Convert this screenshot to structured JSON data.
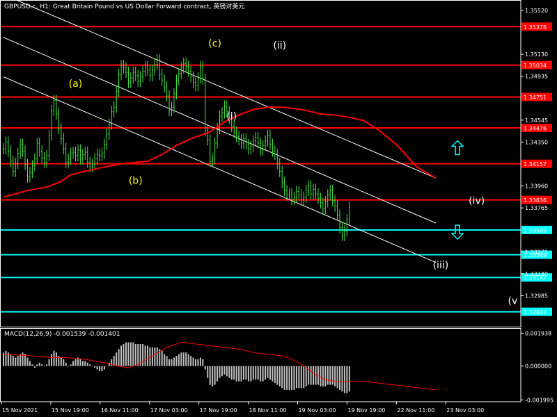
{
  "header": {
    "title": "GBPUSD.c, H1:  Great Britain Pound vs US Dollar Forward contract, 英镑对美元"
  },
  "chart_data": {
    "type": "candlestick",
    "symbol": "GBPUSD.c",
    "timeframe": "H1",
    "price_axis": {
      "ylim": [
        1.3271,
        1.356
      ],
      "ticks": [
        "1.35520",
        "1.35130",
        "1.34935",
        "1.34545",
        "1.34350",
        "1.33960",
        "1.33765",
        "1.33375",
        "1.33180",
        "1.32985"
      ]
    },
    "x_axis": {
      "labels": [
        "15 Nov 2021",
        "15 Nov 19:00",
        "16 Nov 11:00",
        "17 Nov 03:00",
        "17 Nov 19:00",
        "18 Nov 11:00",
        "19 Nov 03:00",
        "19 Nov 19:00",
        "22 Nov 11:00",
        "23 Nov 03:00"
      ]
    },
    "price_closes": [
      1.3429,
      1.3435,
      1.3427,
      1.3418,
      1.3409,
      1.3416,
      1.3425,
      1.3433,
      1.3427,
      1.3415,
      1.3404,
      1.3408,
      1.3414,
      1.342,
      1.3434,
      1.3427,
      1.3421,
      1.3417,
      1.3423,
      1.3441,
      1.3463,
      1.3472,
      1.346,
      1.3447,
      1.3438,
      1.3429,
      1.3417,
      1.342,
      1.3425,
      1.3426,
      1.3423,
      1.3428,
      1.342,
      1.3424,
      1.3426,
      1.3417,
      1.3413,
      1.3415,
      1.342,
      1.3424,
      1.3423,
      1.3425,
      1.3433,
      1.3442,
      1.3451,
      1.3462,
      1.3466,
      1.348,
      1.3495,
      1.3503,
      1.3501,
      1.3497,
      1.3488,
      1.3492,
      1.3497,
      1.3494,
      1.3489,
      1.3493,
      1.3498,
      1.3502,
      1.3499,
      1.3494,
      1.3499,
      1.3504,
      1.3508,
      1.3495,
      1.349,
      1.3484,
      1.3476,
      1.3463,
      1.3466,
      1.3478,
      1.349,
      1.3496,
      1.3501,
      1.3505,
      1.3502,
      1.3498,
      1.3493,
      1.3488,
      1.3485,
      1.3492,
      1.3502,
      1.3491,
      1.3445,
      1.3437,
      1.3418,
      1.342,
      1.3434,
      1.3447,
      1.3458,
      1.3461,
      1.3467,
      1.3462,
      1.3456,
      1.3449,
      1.3444,
      1.344,
      1.3437,
      1.3434,
      1.3438,
      1.3433,
      1.3429,
      1.3431,
      1.3436,
      1.3439,
      1.3434,
      1.3428,
      1.3432,
      1.3436,
      1.3441,
      1.3433,
      1.3427,
      1.3424,
      1.3416,
      1.3409,
      1.3399,
      1.3392,
      1.3388,
      1.3389,
      1.3384,
      1.3386,
      1.3391,
      1.3388,
      1.3384,
      1.3386,
      1.3392,
      1.3396,
      1.3389,
      1.3393,
      1.3389,
      1.3385,
      1.3381,
      1.3376,
      1.3382,
      1.3388,
      1.3392,
      1.3383,
      1.3378,
      1.337,
      1.3359,
      1.3352,
      1.3356,
      1.3366,
      1.3377
    ],
    "moving_average": {
      "color": "#ff0000",
      "values": [
        [
          0,
          1.3386
        ],
        [
          10,
          1.3392
        ],
        [
          18,
          1.3395
        ],
        [
          24,
          1.34
        ],
        [
          28,
          1.3406
        ],
        [
          40,
          1.3412
        ],
        [
          50,
          1.3416
        ],
        [
          60,
          1.3418
        ],
        [
          66,
          1.3424
        ],
        [
          72,
          1.3432
        ],
        [
          78,
          1.3438
        ],
        [
          86,
          1.3444
        ],
        [
          92,
          1.3453
        ],
        [
          98,
          1.3459
        ],
        [
          104,
          1.3464
        ],
        [
          110,
          1.3466
        ],
        [
          116,
          1.3466
        ],
        [
          124,
          1.3464
        ],
        [
          132,
          1.346
        ],
        [
          138,
          1.3459
        ],
        [
          144,
          1.3457
        ],
        [
          150,
          1.3454
        ],
        [
          156,
          1.3446
        ],
        [
          164,
          1.3432
        ],
        [
          172,
          1.3413
        ],
        [
          180,
          1.3403
        ]
      ]
    },
    "horizontal_levels": [
      {
        "value": "1.35376",
        "price": 1.35376,
        "color": "#ff0000"
      },
      {
        "value": "1.35034",
        "price": 1.35034,
        "color": "#ff0000"
      },
      {
        "value": "1.34751",
        "price": 1.34751,
        "color": "#ff0000"
      },
      {
        "value": "1.34476",
        "price": 1.34476,
        "color": "#ff0000"
      },
      {
        "value": "1.34157",
        "price": 1.34157,
        "color": "#ff0000"
      },
      {
        "value": "1.33836",
        "price": 1.33836,
        "color": "#ff0000"
      },
      {
        "value": "1.33569",
        "price": 1.33569,
        "color": "#00ffff"
      },
      {
        "value": "1.33349",
        "price": 1.33349,
        "color": "#00ffff"
      },
      {
        "value": "1.33147",
        "price": 1.33147,
        "color": "#00ffff"
      },
      {
        "value": "1.32842",
        "price": 1.32842,
        "color": "#00ffff"
      }
    ],
    "channel": {
      "color": "#ffffff",
      "lines": [
        [
          [
            0,
            1.3566
          ],
          [
            180,
            1.3403
          ]
        ],
        [
          [
            0,
            1.3528
          ],
          [
            180,
            1.3363
          ]
        ],
        [
          [
            0,
            1.3493
          ],
          [
            180,
            1.3328
          ]
        ]
      ]
    },
    "wave_labels": [
      {
        "text": "(a)",
        "bar": 30,
        "price": 1.3484,
        "color": "#ffff00"
      },
      {
        "text": "(b)",
        "bar": 55,
        "price": 1.3398,
        "color": "#ffff00"
      },
      {
        "text": "(c)",
        "bar": 88,
        "price": 1.352,
        "color": "#ffff00"
      },
      {
        "text": "(ii)",
        "bar": 115,
        "price": 1.3518,
        "color": "#ffffff"
      },
      {
        "text": "(i)",
        "bar": 95,
        "price": 1.3455,
        "color": "#ffffff"
      },
      {
        "text": "(iv)",
        "bar": 197,
        "price": 1.338,
        "color": "#ffffff"
      },
      {
        "text": "(iii)",
        "bar": 182,
        "price": 1.3323,
        "color": "#ffffff"
      },
      {
        "text": "(v",
        "bar": 212,
        "price": 1.3291,
        "color": "#ffffff"
      }
    ],
    "arrows": [
      {
        "direction": "up",
        "bar": 189,
        "price": 1.343,
        "color": "#00ffff"
      },
      {
        "direction": "down",
        "bar": 189,
        "price": 1.3355,
        "color": "#00ffff"
      }
    ],
    "macd": {
      "label": "MACD(12,26,9) -0.001539 -0.001401",
      "params": [
        12,
        26,
        9
      ],
      "main_value": -0.001539,
      "signal_value": -0.001401,
      "ylim": [
        -0.0021,
        0.0022
      ],
      "ticks": [
        "0.001938",
        "0.000000",
        "-0.001995"
      ],
      "histogram": [
        0.0008,
        0.0009,
        0.0008,
        0.0007,
        0.0006,
        0.0005,
        0.0006,
        0.0007,
        0.0008,
        0.0007,
        0.0005,
        0.0003,
        0.0001,
        -0.0001,
        0.0001,
        0.0002,
        0.0001,
        0.0,
        0.0001,
        0.0004,
        0.0007,
        0.0009,
        0.0008,
        0.0006,
        0.0005,
        0.0004,
        0.0002,
        0.0,
        0.0001,
        0.0003,
        0.0004,
        0.0005,
        0.0004,
        0.0003,
        0.0003,
        0.0002,
        0.0001,
        0.0,
        -0.0001,
        -0.0002,
        -0.0003,
        -0.0003,
        -0.0002,
        0.0,
        0.0002,
        0.0004,
        0.0006,
        0.0008,
        0.001,
        0.0012,
        0.0013,
        0.0014,
        0.0014,
        0.0014,
        0.0014,
        0.0013,
        0.0013,
        0.0013,
        0.0013,
        0.0012,
        0.0012,
        0.0011,
        0.0011,
        0.0011,
        0.0011,
        0.001,
        0.0009,
        0.0007,
        0.0006,
        0.0004,
        0.0004,
        0.0005,
        0.0006,
        0.0007,
        0.0008,
        0.0008,
        0.0008,
        0.0007,
        0.0006,
        0.0005,
        0.0004,
        0.0004,
        0.0005,
        0.0004,
        -0.0002,
        -0.0007,
        -0.0011,
        -0.0012,
        -0.0011,
        -0.0009,
        -0.0007,
        -0.0006,
        -0.0005,
        -0.0006,
        -0.0007,
        -0.0008,
        -0.0008,
        -0.0009,
        -0.0009,
        -0.0009,
        -0.0008,
        -0.0008,
        -0.0009,
        -0.0009,
        -0.0008,
        -0.0008,
        -0.0008,
        -0.0009,
        -0.0009,
        -0.0008,
        -0.0007,
        -0.0008,
        -0.0009,
        -0.001,
        -0.0011,
        -0.0012,
        -0.0013,
        -0.0014,
        -0.0014,
        -0.0014,
        -0.0014,
        -0.0014,
        -0.0013,
        -0.0013,
        -0.0013,
        -0.0013,
        -0.0012,
        -0.0011,
        -0.0011,
        -0.0011,
        -0.0011,
        -0.0011,
        -0.0012,
        -0.0012,
        -0.0012,
        -0.0011,
        -0.0011,
        -0.0011,
        -0.0012,
        -0.0013,
        -0.0014,
        -0.0015,
        -0.0016,
        -0.0016,
        -0.0015
      ],
      "signal": [
        [
          0,
          0.0007
        ],
        [
          12,
          0.0006
        ],
        [
          20,
          0.0005
        ],
        [
          26,
          0.0005
        ],
        [
          34,
          0.0004
        ],
        [
          42,
          0.0002
        ],
        [
          48,
          0.0
        ],
        [
          52,
          -0.0001
        ],
        [
          56,
          0.0001
        ],
        [
          62,
          0.0006
        ],
        [
          68,
          0.0011
        ],
        [
          74,
          0.0014
        ],
        [
          80,
          0.0013
        ],
        [
          86,
          0.0012
        ],
        [
          92,
          0.0011
        ],
        [
          98,
          0.001
        ],
        [
          104,
          0.0008
        ],
        [
          110,
          0.0007
        ],
        [
          116,
          0.0006
        ],
        [
          120,
          0.0004
        ],
        [
          124,
          0.0001
        ],
        [
          130,
          -0.0005
        ],
        [
          134,
          -0.0008
        ],
        [
          138,
          -0.0009
        ],
        [
          144,
          -0.0009
        ],
        [
          150,
          -0.0009
        ],
        [
          156,
          -0.001
        ],
        [
          162,
          -0.0011
        ],
        [
          168,
          -0.0012
        ],
        [
          174,
          -0.0013
        ],
        [
          180,
          -0.0014
        ]
      ],
      "signal_color": "#ff0000"
    }
  }
}
